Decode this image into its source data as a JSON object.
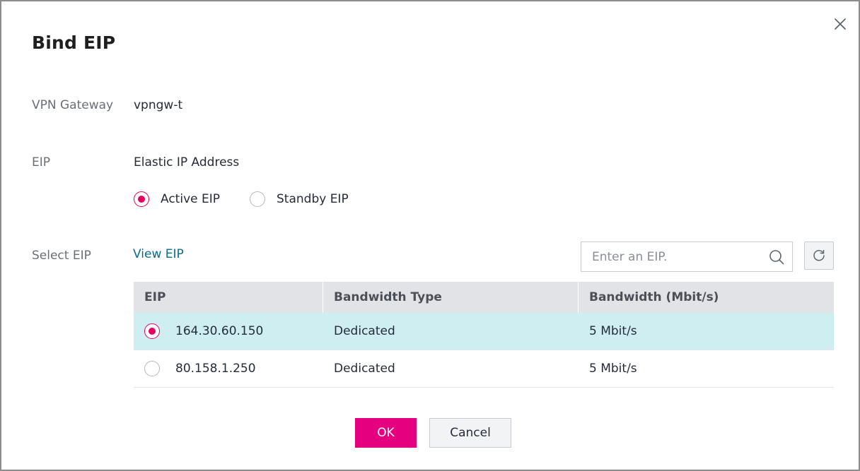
{
  "dialog": {
    "title": "Bind EIP",
    "close_icon": "close-icon"
  },
  "vpn_gateway": {
    "label": "VPN Gateway",
    "value": "vpngw-t"
  },
  "eip": {
    "label": "EIP",
    "value": "Elastic IP Address",
    "options": [
      {
        "label": "Active EIP",
        "checked": true
      },
      {
        "label": "Standby EIP",
        "checked": false
      }
    ]
  },
  "select_eip": {
    "label": "Select EIP",
    "link": "View EIP",
    "search_placeholder": "Enter an EIP.",
    "search_icon": "search-icon",
    "refresh_icon": "refresh-icon"
  },
  "table": {
    "headers": [
      "EIP",
      "Bandwidth Type",
      "Bandwidth (Mbit/s)"
    ],
    "rows": [
      {
        "eip": "164.30.60.150",
        "bandwidth_type": "Dedicated",
        "bandwidth": "5 Mbit/s",
        "selected": true
      },
      {
        "eip": "80.158.1.250",
        "bandwidth_type": "Dedicated",
        "bandwidth": "5 Mbit/s",
        "selected": false
      }
    ]
  },
  "footer": {
    "ok_label": "OK",
    "cancel_label": "Cancel"
  },
  "colors": {
    "accent": "#e4007f",
    "radio_checked": "#e4005f",
    "link": "#0a6c8e",
    "selected_row": "#cfeef1",
    "table_header": "#e1e3e6"
  }
}
